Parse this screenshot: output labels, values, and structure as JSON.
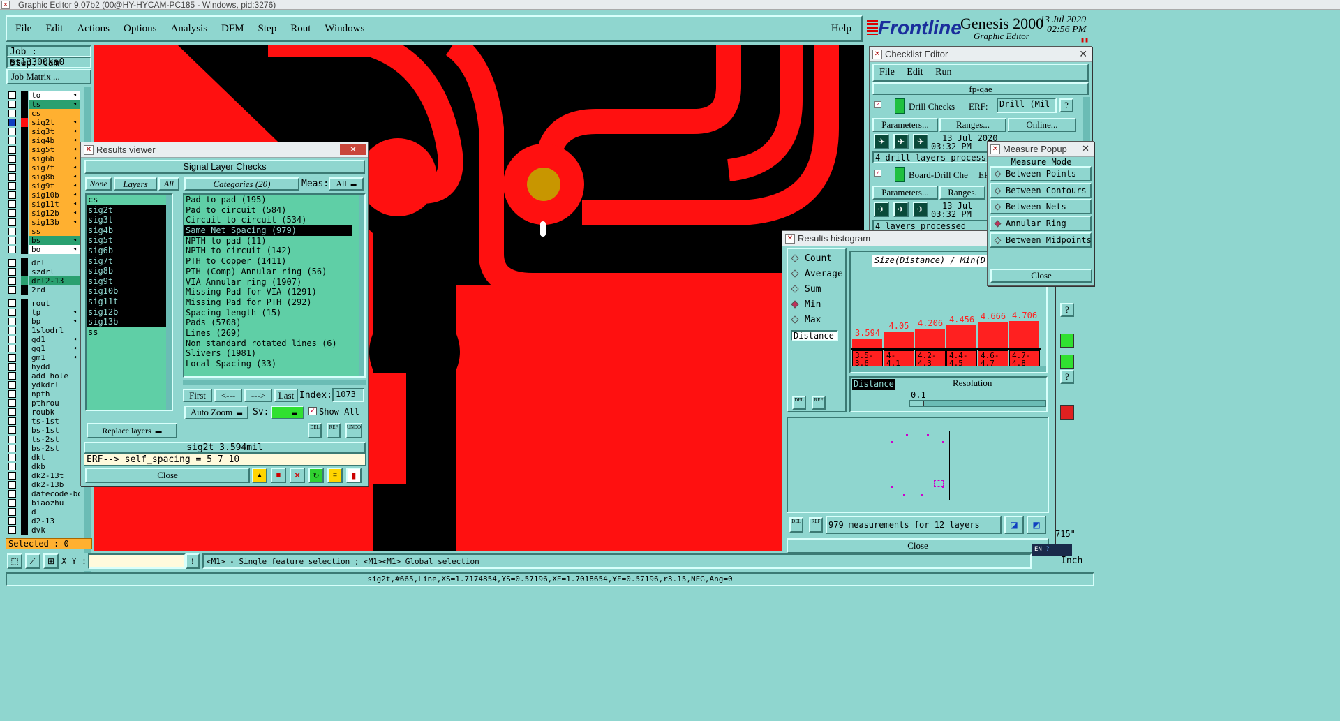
{
  "titlebar": "Graphic Editor 9.07b2 (00@HY-HYCAM-PC185 - Windows, pid:3276)",
  "menu": [
    "File",
    "Edit",
    "Actions",
    "Options",
    "Analysis",
    "DFM",
    "Step",
    "Rout",
    "Windows"
  ],
  "help": "Help",
  "brand": {
    "logo": "Frontline",
    "product": "Genesis 2000",
    "subtitle": "Graphic Editor",
    "date": "13 Jul 2020",
    "time": "02:56 PM"
  },
  "job": {
    "job": "Job : es13300ka0",
    "step": "Step: cam",
    "matrix": "Job Matrix ..."
  },
  "layers_group1": [
    "to",
    "ts",
    "cs",
    "sig2t",
    "sig3t",
    "sig4b",
    "sig5t",
    "sig6b",
    "sig7t",
    "sig8b",
    "sig9t",
    "sig10b",
    "sig11t",
    "sig12b",
    "sig13b",
    "ss",
    "bs",
    "bo"
  ],
  "layers_group2": [
    "drl",
    "szdrl",
    "drl2-13",
    "2rd"
  ],
  "layers_group3": [
    "rout",
    "tp",
    "bp",
    "1slodrl",
    "gd1",
    "gg1",
    "gm1",
    "hydd",
    "add_hole",
    "ydkdrl",
    "npth",
    "pthrou",
    "roubk",
    "ts-1st",
    "bs-1st",
    "ts-2st",
    "bs-2st",
    "dkt",
    "dkb",
    "dk2-13t",
    "dk2-13b",
    "datecode-bo",
    "biaozhu",
    "d",
    "d2-13",
    "dvk"
  ],
  "selected": "Selected : 0",
  "results_viewer": {
    "title": "Results viewer",
    "header": "Signal Layer Checks",
    "none": "None",
    "layers": "Layers",
    "all": "All",
    "layer_list": [
      "cs",
      "sig2t",
      "sig3t",
      "sig4b",
      "sig5t",
      "sig6b",
      "sig7t",
      "sig8b",
      "sig9t",
      "sig10b",
      "sig11t",
      "sig12b",
      "sig13b",
      "ss"
    ],
    "categories_label": "Categories (20)",
    "meas_label": "Meas:",
    "meas_value": "All",
    "categories": [
      "Pad to pad (195)",
      "Pad to circuit (584)",
      "Circuit to circuit (534)",
      "Same Net Spacing (979)",
      "NPTH to pad (11)",
      "NPTH to circuit (142)",
      "PTH to Copper (1411)",
      "PTH (Comp) Annular ring (56)",
      "VIA Annular ring (1907)",
      "Missing Pad for VIA (1291)",
      "Missing Pad for PTH (292)",
      "Spacing length (15)",
      "Pads (5708)",
      "Lines (269)",
      "Non standard rotated lines (6)",
      "Slivers (1981)",
      "Local Spacing (33)"
    ],
    "first": "First",
    "prev": "<---",
    "next": "--->",
    "last": "Last",
    "index_label": "Index:",
    "index_value": "1073",
    "auto_zoom": "Auto Zoom",
    "sv": "Sv:",
    "show_all": "Show All",
    "replace": "Replace layers",
    "del": "DEL",
    "ref": "REF",
    "undo": "UNDO",
    "status": "sig2t 3.594mil",
    "erf": "ERF--> self_spacing = 5 7 10",
    "close": "Close"
  },
  "checklist": {
    "title": "Checklist Editor",
    "menu": [
      "File",
      "Edit",
      "Run"
    ],
    "name": "fp-qae",
    "drill": "Drill Checks",
    "erf": "ERF:",
    "erf_val": "Drill (Mil",
    "params": "Parameters...",
    "ranges": "Ranges...",
    "online": "Online...",
    "date": "13 Jul 2020",
    "time": "03:32 PM",
    "msg1": "4 drill layers process",
    "board": "Board-Drill Che",
    "erf2": "ERF",
    "ranges2": "Ranges.",
    "date2": "13 Jul",
    "msg2": "4 layers processed",
    "q": "?"
  },
  "measure": {
    "title": "Measure Popup",
    "mode": "Measure Mode",
    "items": [
      "Between Points",
      "Between Contours",
      "Between Nets",
      "Annular Ring",
      "Between Midpoints"
    ],
    "close": "Close"
  },
  "histogram": {
    "title": "Results histogram",
    "radios": [
      "Count",
      "Average",
      "Sum",
      "Min",
      "Max"
    ],
    "distance": "Distance",
    "size_label": "Size(Distance) / Min(D",
    "values": [
      3.594,
      4.05,
      4.206,
      4.456,
      4.666,
      4.706
    ],
    "value_labels": [
      "3.594",
      "4.05",
      "4.206",
      "4.456",
      "4.666",
      "4.706"
    ],
    "bins": [
      "3.5-\n3.6",
      "4-\n4.1",
      "4.2-\n4.3",
      "4.4-\n4.5",
      "4.6-\n4.7",
      "4.7-\n4.8"
    ],
    "resolution_label": "Resolution",
    "resolution": "0.1",
    "measurements": "979 measurements for 12 layers",
    "close": "Close"
  },
  "bottom": {
    "xy": "X Y :",
    "hint": "<M1> - Single feature selection ; <M1><M1> Global selection",
    "status": "sig2t,#665,Line,XS=1.7174854,YS=0.57196,XE=1.7018654,YE=0.57196,r3.15,NEG,Ang=0",
    "units": "Inch",
    "coord": "715\""
  }
}
